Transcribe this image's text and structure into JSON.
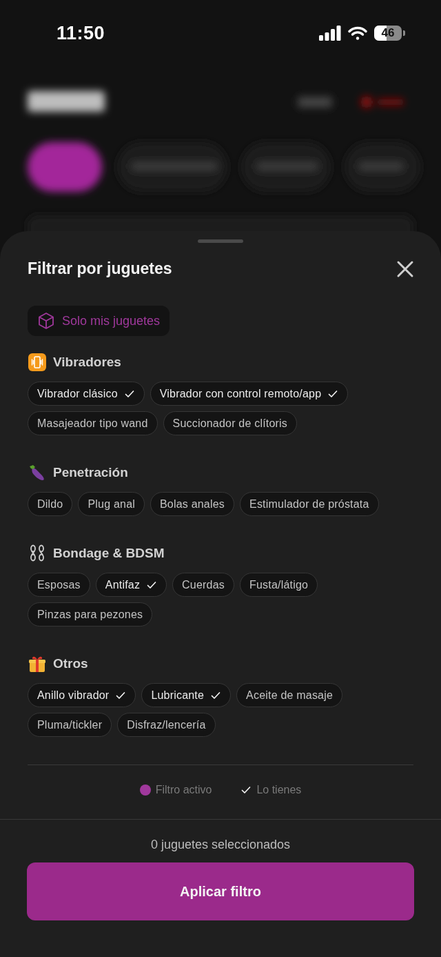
{
  "status_bar": {
    "time": "11:50",
    "battery": "46"
  },
  "sheet": {
    "title": "Filtrar por juguetes",
    "only_mine": {
      "label": "Solo mis juguetes",
      "selected": false
    },
    "sections": [
      {
        "kind": "vibration",
        "title": "Vibradores",
        "items": [
          {
            "label": "Vibrador clásico",
            "owned": true,
            "selected": false
          },
          {
            "label": "Vibrador con control remoto/app",
            "owned": true,
            "selected": false
          },
          {
            "label": "Masajeador tipo wand",
            "owned": false,
            "selected": false
          },
          {
            "label": "Succionador de clítoris",
            "owned": false,
            "selected": false
          }
        ]
      },
      {
        "kind": "eggplant",
        "title": "Penetración",
        "items": [
          {
            "label": "Dildo",
            "owned": false,
            "selected": false
          },
          {
            "label": "Plug anal",
            "owned": false,
            "selected": false
          },
          {
            "label": "Bolas anales",
            "owned": false,
            "selected": false
          },
          {
            "label": "Estimulador de próstata",
            "owned": false,
            "selected": false
          }
        ]
      },
      {
        "kind": "chain",
        "title": "Bondage & BDSM",
        "items": [
          {
            "label": "Esposas",
            "owned": false,
            "selected": false
          },
          {
            "label": "Antifaz",
            "owned": true,
            "selected": false
          },
          {
            "label": "Cuerdas",
            "owned": false,
            "selected": false
          },
          {
            "label": "Fusta/látigo",
            "owned": false,
            "selected": false
          },
          {
            "label": "Pinzas para pezones",
            "owned": false,
            "selected": false
          }
        ]
      },
      {
        "kind": "gift",
        "title": "Otros",
        "items": [
          {
            "label": "Anillo vibrador",
            "owned": true,
            "selected": false
          },
          {
            "label": "Lubricante",
            "owned": true,
            "selected": false
          },
          {
            "label": "Aceite de masaje",
            "owned": false,
            "selected": false
          },
          {
            "label": "Pluma/tickler",
            "owned": false,
            "selected": false
          },
          {
            "label": "Disfraz/lencería",
            "owned": false,
            "selected": false
          }
        ]
      }
    ],
    "legend": [
      {
        "kind": "dot",
        "label": "Filtro activo",
        "color": "#a0389c"
      },
      {
        "kind": "check",
        "label": "Lo tienes"
      }
    ],
    "selected_count": "0 juguetes seleccionados",
    "apply_button": "Aplicar filtro"
  }
}
